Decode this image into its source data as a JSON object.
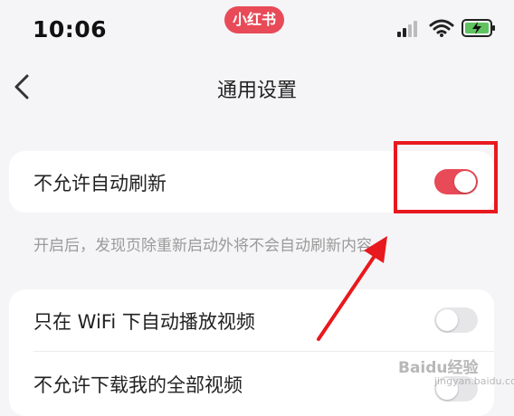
{
  "status_bar": {
    "time": "10:06",
    "app_badge": "小红书",
    "icons": [
      "signal-icon",
      "wifi-icon",
      "battery-charging-icon"
    ]
  },
  "nav": {
    "back_icon": "chevron-left-icon",
    "title": "通用设置"
  },
  "settings": {
    "auto_refresh": {
      "label": "不允许自动刷新",
      "enabled": true,
      "hint": "开启后，发现页除重新启动外将不会自动刷新内容"
    },
    "wifi_autoplay": {
      "label": "只在 WiFi 下自动播放视频",
      "enabled": false
    },
    "disallow_download": {
      "label": "不允许下载我的全部视频",
      "enabled": false
    }
  },
  "colors": {
    "accent": "#e84a57",
    "annotation": "#e8191e",
    "background": "#f5f5f7"
  },
  "watermark": {
    "text": "Baidu经验",
    "sub": "jingyan.baidu.com"
  }
}
